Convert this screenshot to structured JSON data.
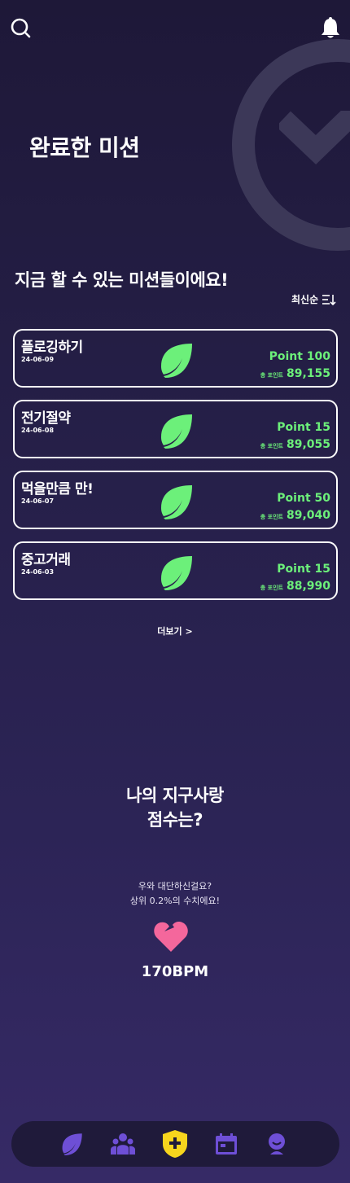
{
  "header": {
    "search_icon": "search-icon",
    "bell_icon": "bell-icon"
  },
  "hero": {
    "title": "완료한 미션"
  },
  "missions_section": {
    "title": "지금 할 수 있는 미션들이에요!",
    "sort_label": "최신순",
    "items": [
      {
        "name": "플로깅하기",
        "date": "24-06-09",
        "point": "Point 100",
        "total_label": "총 포인트",
        "total": "89,155"
      },
      {
        "name": "전기절약",
        "date": "24-06-08",
        "point": "Point 15",
        "total_label": "총 포인트",
        "total": "89,055"
      },
      {
        "name": "먹을만큼 만!",
        "date": "24-06-07",
        "point": "Point 50",
        "total_label": "총 포인트",
        "total": "89,040"
      },
      {
        "name": "중고거래",
        "date": "24-06-03",
        "point": "Point 15",
        "total_label": "총 포인트",
        "total": "88,990"
      }
    ],
    "more_label": "더보기 >"
  },
  "score": {
    "title_line1": "나의 지구사랑",
    "title_line2": "점수는?",
    "desc_line1": "우와 대단하신걸요?",
    "desc_line2": "상위 0.2%의 수치에요!",
    "bpm": "170BPM"
  },
  "colors": {
    "accent_green": "#6cf07a",
    "heart_pink": "#f4679c",
    "nav_purple": "#6e4fd6",
    "nav_active_yellow": "#f7d51d",
    "background": "#241e45"
  },
  "bottom_nav": {
    "items": [
      "leaf-icon",
      "group-icon",
      "shield-plus-icon",
      "calendar-icon",
      "profile-icon"
    ],
    "active": "shield-plus-icon"
  }
}
